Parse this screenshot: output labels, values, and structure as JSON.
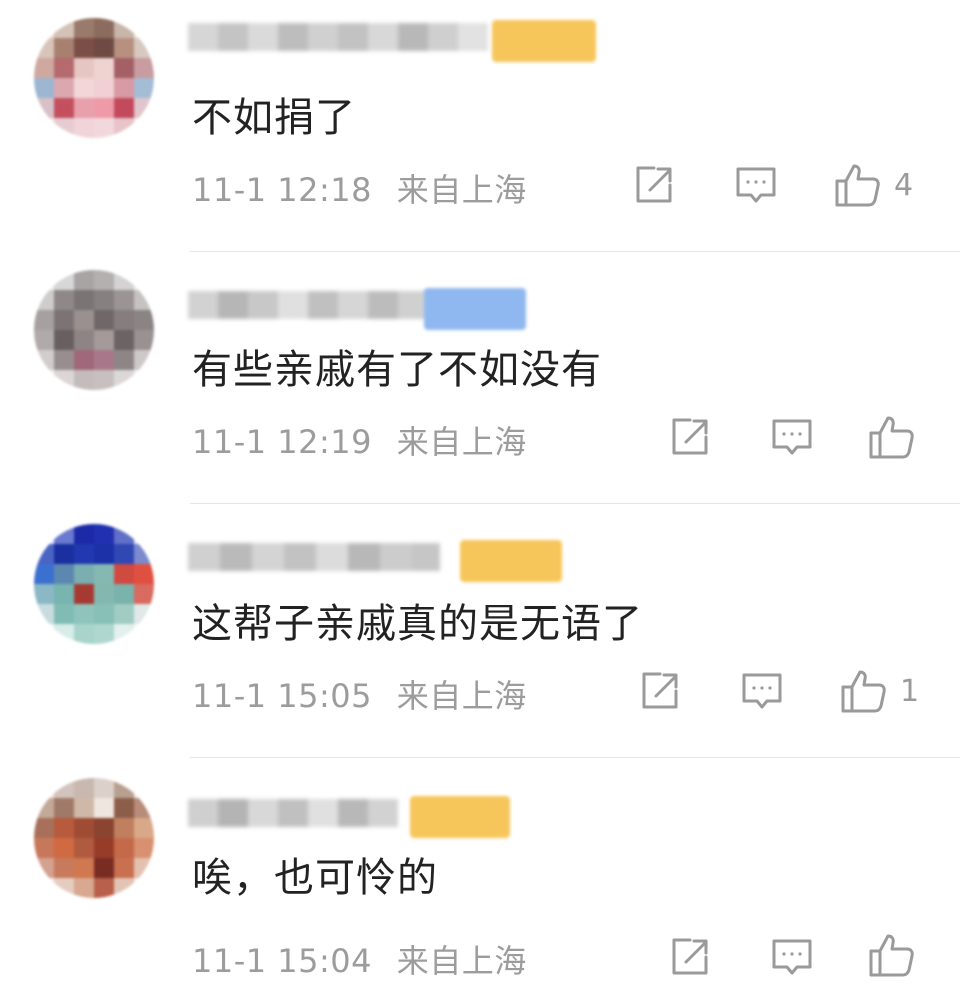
{
  "comments": [
    {
      "text": "不如捐了",
      "time": "11-1 12:18",
      "location": "来自上海",
      "likes": "4",
      "badge_color": "#f7c65a"
    },
    {
      "text": "有些亲戚有了不如没有",
      "time": "11-1 12:19",
      "location": "来自上海",
      "likes": "",
      "badge_color": "#8fb8f0"
    },
    {
      "text": "这帮子亲戚真的是无语了",
      "time": "11-1 15:05",
      "location": "来自上海",
      "likes": "1",
      "badge_color": "#f7c65a"
    },
    {
      "text": "唉，也可怜的",
      "time": "11-1 15:04",
      "location": "来自上海",
      "likes": "",
      "badge_color": "#f7c65a"
    }
  ],
  "icons": {
    "share": "share-icon",
    "comment": "comment-icon",
    "like": "thumbs-up-icon"
  },
  "colors": {
    "text": "#222222",
    "meta": "#9c9c9c",
    "icon": "#9a9a9a",
    "divider": "#e6e6e6"
  }
}
